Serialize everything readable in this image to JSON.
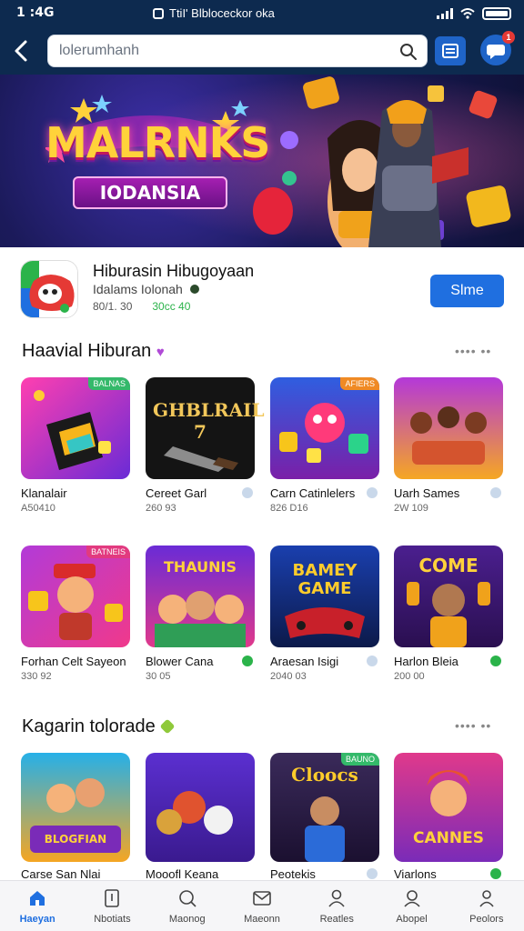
{
  "status_bar": {
    "time": "1 :4G",
    "center_text": "TtiI' Blbloceckor oka"
  },
  "search": {
    "value": "lolerumhanh",
    "placeholder": "lolerumhanh"
  },
  "notifications": {
    "badge": "1"
  },
  "banner": {
    "logo_main": "MALRNKS",
    "logo_sub": "IODANSIA"
  },
  "app": {
    "name": "Hiburasin Hibugoyaan",
    "developer": "Idalams Iolonah",
    "downloads": "80/1. 30",
    "rating": "30cc 40",
    "install_label": "Slme"
  },
  "section1": {
    "title": "Haavial Hiburan",
    "more": "•••• ••"
  },
  "section2": {
    "title": "Kagarin tolorade",
    "more": "•••• ••"
  },
  "row1": [
    {
      "name": "Klanalair",
      "sub": "A50410",
      "tag": "BALNAS"
    },
    {
      "name": "Cereet Garl",
      "sub": "260 93",
      "tag": ""
    },
    {
      "name": "Carn Catinlelers",
      "sub": "826 D16",
      "tag": "AFIERS"
    },
    {
      "name": "Uarh Sames",
      "sub": "2W 109",
      "tag": ""
    }
  ],
  "row2": [
    {
      "name": "Forhan Celt Sayeon",
      "sub": "330 92",
      "tag": "BATNEIS"
    },
    {
      "name": "Blower Cana",
      "sub": "30 05",
      "tag": ""
    },
    {
      "name": "Araesan Isigi",
      "sub": "2040 03",
      "tag": ""
    },
    {
      "name": "Harlon Bleia",
      "sub": "200 00",
      "tag": ""
    }
  ],
  "row3": [
    {
      "name": "Carse San Nlai",
      "tag": ""
    },
    {
      "name": "Mooofl Keana",
      "tag": ""
    },
    {
      "name": "Peotekis",
      "tag": "BAUNO"
    },
    {
      "name": "Viarlons",
      "tag": ""
    }
  ],
  "cover_text": {
    "r1c2": "GHBLRAIL 7",
    "r2c2": "THAUNIS",
    "r2c3": "BAMEY GAME",
    "r2c4": "COME",
    "r3c3": "Cloocs",
    "r3c4": "CANNES",
    "r3c1": "BLOGFIAN"
  },
  "nav": [
    {
      "label": "Haeyan"
    },
    {
      "label": "Nbotiats"
    },
    {
      "label": "Maonog"
    },
    {
      "label": "Maeonn"
    },
    {
      "label": "Reatles"
    },
    {
      "label": "Abopel"
    },
    {
      "label": "Peolors"
    }
  ],
  "colors": {
    "header_bg": "#0d2a4f",
    "accent": "#1f6fe0",
    "green": "#2bb34a"
  }
}
